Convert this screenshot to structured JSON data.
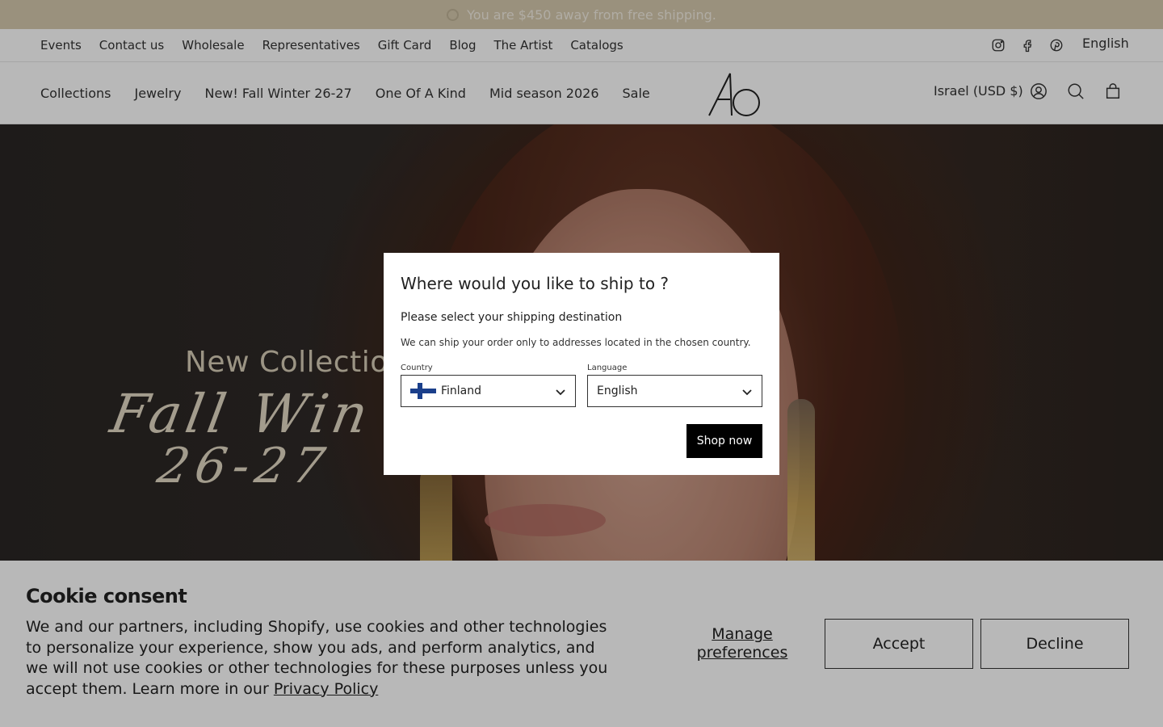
{
  "announcement": {
    "text": "You are $450 away from free shipping.",
    "progress": 0
  },
  "utility_nav": {
    "items": [
      "Events",
      "Contact us",
      "Wholesale",
      "Representatives",
      "Gift Card",
      "Blog",
      "The Artist",
      "Catalogs"
    ],
    "socials": [
      "instagram-icon",
      "facebook-icon",
      "pinterest-icon"
    ],
    "language": "English"
  },
  "main_nav": {
    "items": [
      "Collections",
      "Jewelry",
      "New! Fall Winter 26-27",
      "One Of A Kind",
      "Mid season 2026",
      "Sale"
    ],
    "logo_text": "AO",
    "currency": "Israel (USD $)",
    "icons": [
      "account-icon",
      "search-icon",
      "cart-icon"
    ]
  },
  "hero": {
    "line1": "New Collection",
    "line2": "Fall Win",
    "line3": "26-27"
  },
  "modal": {
    "title": "Where would you like to ship to ?",
    "subtitle": "Please select your shipping destination",
    "note": "We can ship your order only to addresses located in the chosen country.",
    "country_label": "Country",
    "country_value": "Finland",
    "language_label": "Language",
    "language_value": "English",
    "button": "Shop now"
  },
  "cookie": {
    "title": "Cookie consent",
    "text": "We and our partners, including Shopify, use cookies and other technologies to personalize your experience, show you ads, and perform analytics, and we will not use cookies or other technologies for these purposes unless you accept them. Learn more in our",
    "link": "Privacy Policy",
    "manage": "Manage preferences",
    "accept": "Accept",
    "decline": "Decline"
  },
  "colors": {
    "announce_bg": "#d6c9ad",
    "button_dark": "#000000"
  }
}
